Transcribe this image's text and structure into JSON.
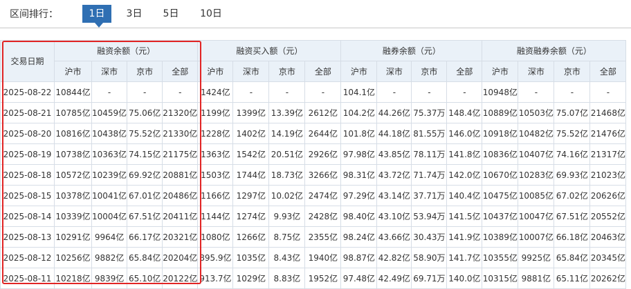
{
  "rank_label": "区间排行：",
  "tabs": [
    "1日",
    "3日",
    "5日",
    "10日"
  ],
  "active_tab": 0,
  "table": {
    "date_header": "交易日期",
    "groups": [
      "融资余额（元）",
      "融资买入额（元）",
      "融券余额（元）",
      "融资融券余额（元）"
    ],
    "subheaders": [
      "沪市",
      "深市",
      "京市",
      "全部"
    ],
    "rows": [
      {
        "date": "2025-08-22",
        "cells": [
          "10844亿",
          "-",
          "-",
          "-",
          "1424亿",
          "-",
          "-",
          "-",
          "104.1亿",
          "-",
          "-",
          "-",
          "10948亿",
          "-",
          "-",
          "-"
        ]
      },
      {
        "date": "2025-08-21",
        "cells": [
          "10785亿",
          "10459亿",
          "75.06亿",
          "21320亿",
          "1199亿",
          "1399亿",
          "13.39亿",
          "2612亿",
          "104.2亿",
          "44.26亿",
          "75.37万",
          "148.4亿",
          "10889亿",
          "10503亿",
          "75.07亿",
          "21468亿"
        ]
      },
      {
        "date": "2025-08-20",
        "cells": [
          "10816亿",
          "10438亿",
          "75.52亿",
          "21330亿",
          "1228亿",
          "1402亿",
          "14.19亿",
          "2644亿",
          "101.8亿",
          "44.18亿",
          "81.55万",
          "146.0亿",
          "10918亿",
          "10482亿",
          "75.52亿",
          "21476亿"
        ]
      },
      {
        "date": "2025-08-19",
        "cells": [
          "10738亿",
          "10363亿",
          "74.15亿",
          "21175亿",
          "1363亿",
          "1542亿",
          "20.51亿",
          "2926亿",
          "97.98亿",
          "43.85亿",
          "78.11万",
          "141.8亿",
          "10836亿",
          "10407亿",
          "74.16亿",
          "21317亿"
        ]
      },
      {
        "date": "2025-08-18",
        "cells": [
          "10572亿",
          "10239亿",
          "69.92亿",
          "20881亿",
          "1503亿",
          "1744亿",
          "18.73亿",
          "3266亿",
          "98.31亿",
          "43.72亿",
          "71.74万",
          "142.0亿",
          "10670亿",
          "10283亿",
          "69.93亿",
          "21023亿"
        ]
      },
      {
        "date": "2025-08-15",
        "cells": [
          "10378亿",
          "10041亿",
          "67.01亿",
          "20486亿",
          "1166亿",
          "1297亿",
          "10.02亿",
          "2474亿",
          "97.29亿",
          "43.14亿",
          "37.71万",
          "140.4亿",
          "10475亿",
          "10085亿",
          "67.02亿",
          "20626亿"
        ]
      },
      {
        "date": "2025-08-14",
        "cells": [
          "10339亿",
          "10004亿",
          "67.51亿",
          "20411亿",
          "1144亿",
          "1274亿",
          "9.93亿",
          "2428亿",
          "98.40亿",
          "43.10亿",
          "53.94万",
          "141.5亿",
          "10437亿",
          "10047亿",
          "67.51亿",
          "20552亿"
        ]
      },
      {
        "date": "2025-08-13",
        "cells": [
          "10291亿",
          "9964亿",
          "66.17亿",
          "20321亿",
          "1080亿",
          "1266亿",
          "8.75亿",
          "2355亿",
          "98.24亿",
          "43.66亿",
          "30.43万",
          "141.9亿",
          "10389亿",
          "10007亿",
          "66.18亿",
          "20463亿"
        ]
      },
      {
        "date": "2025-08-12",
        "cells": [
          "10256亿",
          "9882亿",
          "65.84亿",
          "20204亿",
          "895.9亿",
          "1035亿",
          "8.43亿",
          "1940亿",
          "98.87亿",
          "42.82亿",
          "58.90万",
          "141.7亿",
          "10355亿",
          "9925亿",
          "65.84亿",
          "20345亿"
        ]
      },
      {
        "date": "2025-08-11",
        "cells": [
          "10218亿",
          "9839亿",
          "65.10亿",
          "20122亿",
          "913.7亿",
          "1029亿",
          "8.83亿",
          "1952亿",
          "97.48亿",
          "42.49亿",
          "69.71万",
          "140.0亿",
          "10315亿",
          "9881亿",
          "65.11亿",
          "20262亿"
        ]
      }
    ]
  },
  "colors": {
    "active_tab": "#2f6fb3",
    "highlight_border": "#e12424",
    "header_bg": "#eaf1f8",
    "grid": "#d6dde6"
  }
}
